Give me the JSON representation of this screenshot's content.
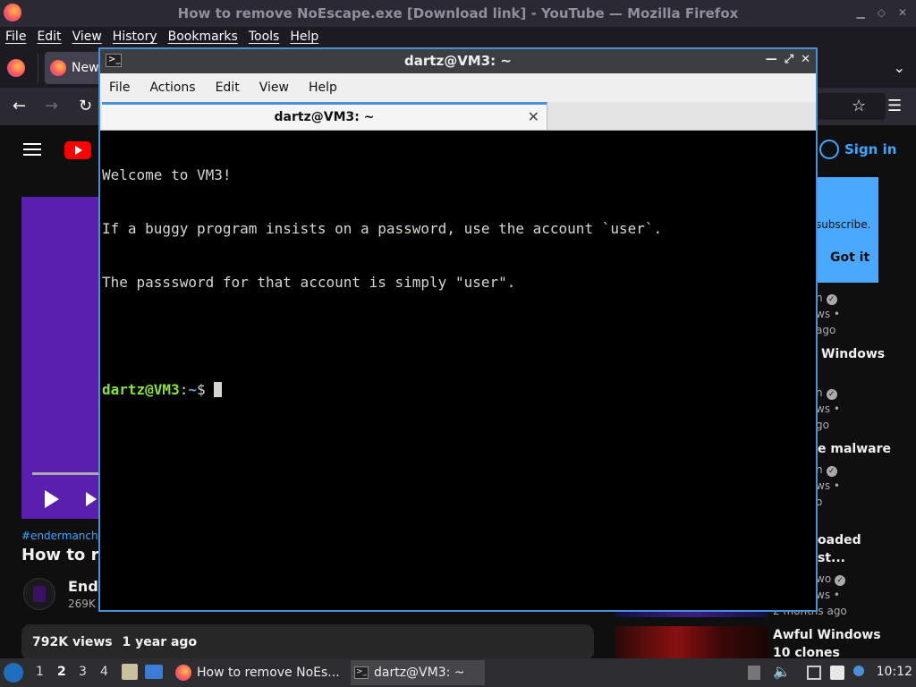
{
  "firefox": {
    "window_title": "How to remove NoEscape.exe [Download link] - YouTube — Mozilla Firefox",
    "menu": [
      "File",
      "Edit",
      "View",
      "History",
      "Bookmarks",
      "Tools",
      "Help"
    ],
    "active_tab_label": "New"
  },
  "youtube": {
    "signin_label": "Sign in",
    "popup_text": "subscribe.",
    "popup_button": "Got it",
    "hashtags": "#endermanch #",
    "video_title": "How to rem",
    "channel_name": "Ende",
    "channel_subs": "269K",
    "views": "792K views",
    "age": "1 year ago",
    "recommendations": [
      {
        "title": "",
        "meta1": "n",
        "meta2": "ws •",
        "meta3": "ago"
      },
      {
        "title": "Windows",
        "meta1": "n",
        "meta2": "ws •",
        "meta3": "go"
      },
      {
        "title": "e malware",
        "meta1": "n",
        "meta2": "ws •",
        "meta3": "o"
      },
      {
        "title": "oaded",
        "title2": "st...",
        "meta1": "wo",
        "meta2": "ws •",
        "meta3": "2 months ago"
      },
      {
        "title": "Awful Windows",
        "title2": "10 clones"
      }
    ]
  },
  "terminal": {
    "title": "dartz@VM3: ~",
    "menu": [
      "File",
      "Actions",
      "Edit",
      "View",
      "Help"
    ],
    "tab_label": "dartz@VM3: ~",
    "lines": [
      "Welcome to VM3!",
      "If a buggy program insists on a password, use the account `user`.",
      "The passsword for that account is simply \"user\".",
      ""
    ],
    "prompt_user": "dartz@VM3",
    "prompt_sep": ":",
    "prompt_path": "~",
    "prompt_symbol": "$ "
  },
  "taskbar": {
    "workspaces": [
      "1",
      "2",
      "3",
      "4"
    ],
    "active_workspace": "2",
    "task_firefox": "How to remove NoEs...",
    "task_terminal": "dartz@VM3: ~",
    "clock": "10:12"
  }
}
